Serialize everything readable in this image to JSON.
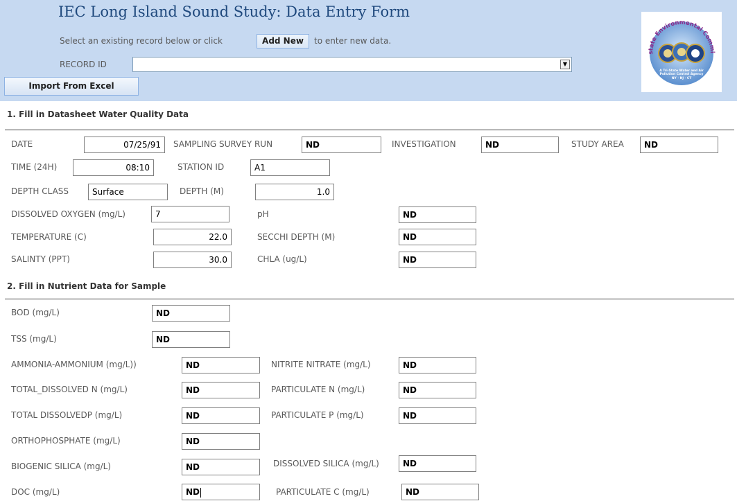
{
  "header": {
    "title": "IEC Long Island Sound Study: Data Entry Form",
    "instr_pre": "Select an existing record below or click",
    "add_new": "Add New",
    "instr_post": "to enter new data.",
    "record_id_label": "RECORD ID",
    "record_id_value": "",
    "import_label": "Import From Excel",
    "logo_text_top": "Interstate Environmental Commission",
    "logo_text_bottom": "A Tri-State Water and Air Pollution Control Agency",
    "logo_states": "NY · NJ · CT"
  },
  "section1": {
    "heading": "1. Fill in Datasheet Water Quality Data",
    "date_label": "DATE",
    "date_value": "07/25/91",
    "survey_label": "SAMPLING SURVEY RUN",
    "survey_value": "ND",
    "investigation_label": "INVESTIGATION",
    "investigation_value": "ND",
    "study_area_label": "STUDY AREA",
    "study_area_value": "ND",
    "time_label": "TIME (24H)",
    "time_value": "08:10",
    "station_label": "STATION ID",
    "station_value": "A1",
    "depth_class_label": "DEPTH CLASS",
    "depth_class_value": "Surface",
    "depth_label": "DEPTH (M)",
    "depth_value": "1.0",
    "do_label": "DISSOLVED OXYGEN (mg/L)",
    "do_value": "7",
    "ph_label": "pH",
    "ph_value": "ND",
    "temp_label": "TEMPERATURE (C)",
    "temp_value": "22.0",
    "secchi_label": "SECCHI DEPTH (M)",
    "secchi_value": "ND",
    "salinity_label": "SALINTY (PPT)",
    "salinity_value": "30.0",
    "chla_label": "CHLA (ug/L)",
    "chla_value": "ND"
  },
  "section2": {
    "heading": "2. Fill in Nutrient Data for Sample",
    "bod_label": "BOD (mg/L)",
    "bod_value": "ND",
    "tss_label": "TSS (mg/L)",
    "tss_value": "ND",
    "ammonia_label": "AMMONIA-AMMONIUM (mg/L))",
    "ammonia_value": "ND",
    "nitrite_label": "NITRITE NITRATE (mg/L)",
    "nitrite_value": "ND",
    "tdn_label": "TOTAL_DISSOLVED N (mg/L)",
    "tdn_value": "ND",
    "pn_label": "PARTICULATE N (mg/L)",
    "pn_value": "ND",
    "tdp_label": "TOTAL DISSOLVEDP (mg/L)",
    "tdp_value": "ND",
    "pp_label": "PARTICULATE P (mg/L)",
    "pp_value": "ND",
    "ortho_label": "ORTHOPHOSPHATE (mg/L)",
    "ortho_value": "ND",
    "bsi_label": "BIOGENIC SILICA (mg/L)",
    "bsi_value": "ND",
    "dsi_label": "DISSOLVED SILICA (mg/L)",
    "dsi_value": "ND",
    "doc_label": "DOC (mg/L)",
    "doc_value": "ND",
    "pc_label": "PARTICULATE C (mg/L)",
    "pc_value": "ND"
  },
  "colors": {
    "header_bg": "#c6d9f1",
    "title": "#1f497d",
    "label": "#595959"
  }
}
